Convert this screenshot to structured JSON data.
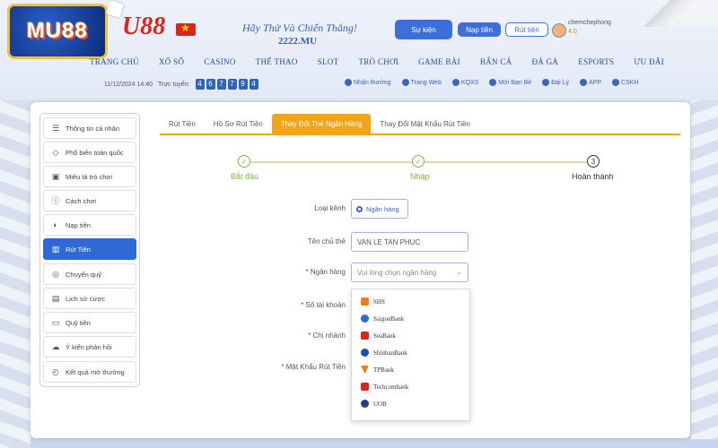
{
  "header": {
    "logo_text": "MU88",
    "brand_text": "U88",
    "slogan": "Hãy Thử Và Chiến Thắng!",
    "domain": "2222.MU",
    "event_button": "Sự kiện",
    "deposit_button": "Nạp tiền",
    "withdraw_button": "Rút tiền",
    "username": "chemchephong",
    "balance": "4.0",
    "nav": [
      "TRANG CHỦ",
      "XỔ SỐ",
      "CASINO",
      "THỂ THAO",
      "SLOT",
      "TRÒ CHƠI",
      "GAME BÀI",
      "BẮN CÁ",
      "ĐÁ GÀ",
      "ESPORTS",
      "ƯU ĐÃI"
    ],
    "datetime": "11/12/2024 14:40",
    "online_label": "Trực tuyến:",
    "online_digits": [
      "4",
      "6",
      "7",
      "7",
      "9",
      "4"
    ],
    "top_links": [
      "Nhận thưởng",
      "Trang Web",
      "KQXS",
      "Mời Bạn Bè",
      "Đại Lý",
      "APP",
      "CSKH"
    ]
  },
  "sidebar": {
    "items": [
      {
        "label": "Thông tin cá nhân",
        "icon": "user-card-icon",
        "glyph": "☰"
      },
      {
        "label": "Phổ biến toàn quốc",
        "icon": "diamond-icon",
        "glyph": "◇"
      },
      {
        "label": "Miêu tả trò chơi",
        "icon": "gamepad-icon",
        "glyph": "▣"
      },
      {
        "label": "Cách chơi",
        "icon": "info-icon",
        "glyph": "ⓘ"
      },
      {
        "label": "Nạp tiền",
        "icon": "piggy-bank-icon",
        "glyph": "◐"
      },
      {
        "label": "Rút Tiền",
        "icon": "withdraw-icon",
        "glyph": "▥",
        "active": true
      },
      {
        "label": "Chuyển quỹ",
        "icon": "transfer-icon",
        "glyph": "◎"
      },
      {
        "label": "Lịch sử cược",
        "icon": "history-doc-icon",
        "glyph": "▤"
      },
      {
        "label": "Quỹ tiền",
        "icon": "wallet-icon",
        "glyph": "▭"
      },
      {
        "label": "Ý kiến phản hồi",
        "icon": "feedback-icon",
        "glyph": "☁"
      },
      {
        "label": "Kết quả mở thưởng",
        "icon": "clock-icon",
        "glyph": "◴"
      }
    ]
  },
  "tabs": [
    {
      "label": "Rút Tiền",
      "active": false
    },
    {
      "label": "Hồ Sơ Rút Tiền",
      "active": false
    },
    {
      "label": "Thay Đổi Thẻ Ngân Hàng",
      "active": true
    },
    {
      "label": "Thay Đổi Mật Khẩu Rút Tiền",
      "active": false
    }
  ],
  "steps": [
    {
      "label": "Bắt đầu",
      "mark": "✓",
      "state": "done"
    },
    {
      "label": "Nhập",
      "mark": "✓",
      "state": "done"
    },
    {
      "label": "Hoàn thành",
      "mark": "3",
      "state": "current"
    }
  ],
  "form": {
    "channel_label": "Loại kênh",
    "channel_value": "Ngân hàng",
    "holder_label": "Tên chủ thẻ",
    "holder_value": "VAN LE TAN PHUC",
    "bank_label": "* Ngân hàng",
    "bank_placeholder": "Vui lòng chọn ngân hàng",
    "account_label": "* Số tài khoản",
    "branch_label": "* Chi nhánh",
    "password_label": "* Mật Khẩu Rút Tiền"
  },
  "bank_options": [
    {
      "name": "SHS",
      "color": "#f07b1a"
    },
    {
      "name": "SaigonBank",
      "color": "#2f69d6"
    },
    {
      "name": "SeaBank",
      "color": "#d9251d"
    },
    {
      "name": "ShinhanBank",
      "color": "#1d4fa8"
    },
    {
      "name": "TPBank",
      "color": "#f07b1a"
    },
    {
      "name": "Techcombank",
      "color": "#d9251d"
    },
    {
      "name": "UOB",
      "color": "#1d3f8a"
    }
  ],
  "colors": {
    "accent": "#2f69d6",
    "tab_active": "#f3a51a",
    "step_done": "#7fb547"
  }
}
